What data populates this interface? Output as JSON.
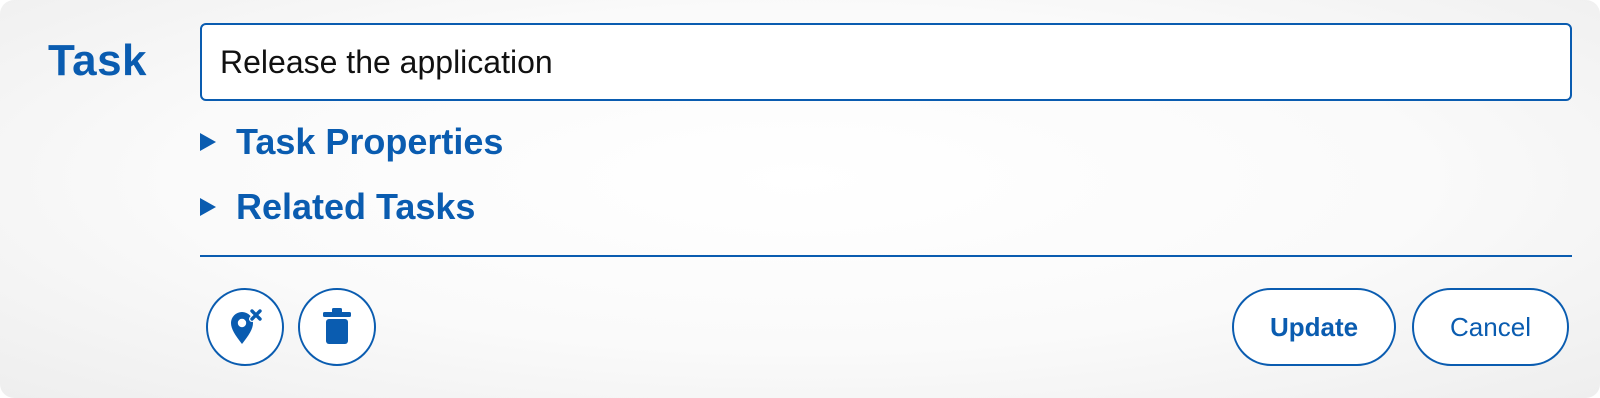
{
  "form": {
    "title": "Task",
    "task_input": {
      "value": "Release the application",
      "placeholder": ""
    },
    "sections": [
      {
        "label": "Task Properties",
        "expanded": false
      },
      {
        "label": "Related Tasks",
        "expanded": false
      }
    ]
  },
  "actions": {
    "location_icon": "location-remove-icon",
    "delete_icon": "trash-icon",
    "update_label": "Update",
    "cancel_label": "Cancel"
  },
  "colors": {
    "accent": "#0a5cb0",
    "background": "#f7f7f7",
    "input_background": "#ffffff",
    "text": "#111111"
  }
}
